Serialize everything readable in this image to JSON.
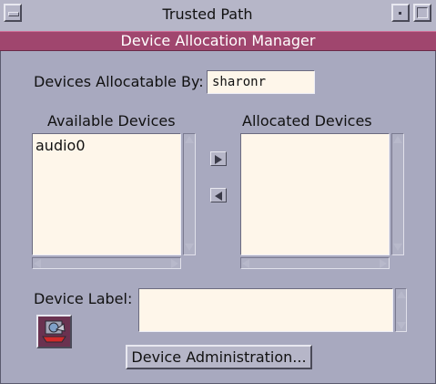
{
  "window": {
    "title": "Trusted Path"
  },
  "header": {
    "title": "Device Allocation Manager"
  },
  "owner": {
    "label": "Devices Allocatable By:",
    "value": "sharonr"
  },
  "available": {
    "heading": "Available Devices",
    "items": [
      "audio0"
    ]
  },
  "allocated": {
    "heading": "Allocated Devices",
    "items": []
  },
  "device_label": {
    "label": "Device Label:",
    "value": ""
  },
  "buttons": {
    "allocate_icon": "right-triangle-icon",
    "deallocate_icon": "left-triangle-icon",
    "admin": "Device Administration..."
  },
  "colors": {
    "accent": "#a0466e",
    "background": "#a8a9bf",
    "field": "#fef6ea"
  }
}
